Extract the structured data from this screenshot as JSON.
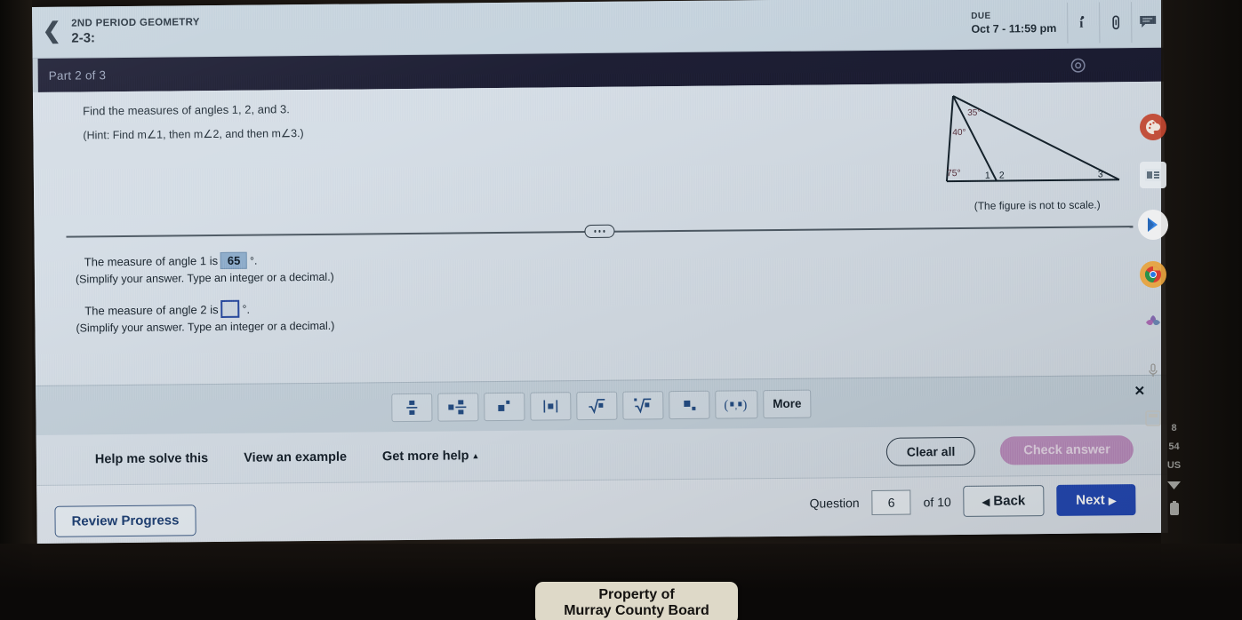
{
  "header": {
    "back_icon": "chevron-left-icon",
    "course": "2ND PERIOD GEOMETRY",
    "assignment": "2-3:",
    "due_label": "DUE",
    "due_date": "Oct 7 - 11:59 pm",
    "icons": [
      "info-icon",
      "paperclip-icon",
      "message-icon"
    ]
  },
  "part_bar": {
    "text": "Part 2 of 3",
    "settings_icon": "gear-icon"
  },
  "problem": {
    "prompt": "Find the measures of angles 1, 2, and 3.",
    "hint": "(Hint: Find m∠1, then m∠2, and then m∠3.)",
    "figure_caption": "(The figure is not to scale.)",
    "figure": {
      "angle_apex_upper": "35°",
      "angle_apex_lower": "40°",
      "angle_bottom_left": "75°",
      "label_1": "1",
      "label_2": "2",
      "label_3": "3"
    }
  },
  "answers": [
    {
      "text_before": "The measure of angle 1 is",
      "value": "65",
      "degree": "°",
      "text_after": ".",
      "instruction": "(Simplify your answer. Type an integer or a decimal.)",
      "filled": true
    },
    {
      "text_before": "The measure of angle 2 is",
      "value": "",
      "degree": "°",
      "text_after": ".",
      "instruction": "(Simplify your answer. Type an integer or a decimal.)",
      "filled": false
    }
  ],
  "palette": {
    "close_icon": "close-icon",
    "buttons": [
      {
        "name": "fraction",
        "label": "■⁄■"
      },
      {
        "name": "mixed-number",
        "label": "■■⁄■"
      },
      {
        "name": "exponent",
        "label": "■▪"
      },
      {
        "name": "absolute-value",
        "label": "|■|"
      },
      {
        "name": "square-root",
        "label": "√■"
      },
      {
        "name": "nth-root",
        "label": "∛■"
      },
      {
        "name": "subscript",
        "label": "■▪"
      },
      {
        "name": "interval",
        "label": "(▪,▪)"
      },
      {
        "name": "more",
        "label": "More"
      }
    ]
  },
  "help_row": {
    "help_me_solve": "Help me solve this",
    "view_example": "View an example",
    "get_more_help": "Get more help",
    "get_more_help_caret": "▲",
    "clear_all": "Clear all",
    "check_answer": "Check answer"
  },
  "bottom_nav": {
    "review_progress": "Review Progress",
    "question_label": "Question",
    "question_number": "6",
    "of_label": "of 10",
    "back": "Back",
    "back_icon": "◀",
    "next": "Next",
    "next_icon": "▶"
  },
  "device": {
    "dock_icons": [
      "palette-icon",
      "news-icon",
      "play-store-icon",
      "chrome-icon",
      "photos-icon",
      "microphone-icon",
      "calculator-icon"
    ],
    "status": {
      "time_hour": "8",
      "time_minute": "54",
      "locale": "US",
      "wifi_icon": "wifi-icon",
      "battery_icon": "battery-icon"
    }
  },
  "sticker": {
    "line1": "Property of",
    "line2": "Murray County Board"
  }
}
